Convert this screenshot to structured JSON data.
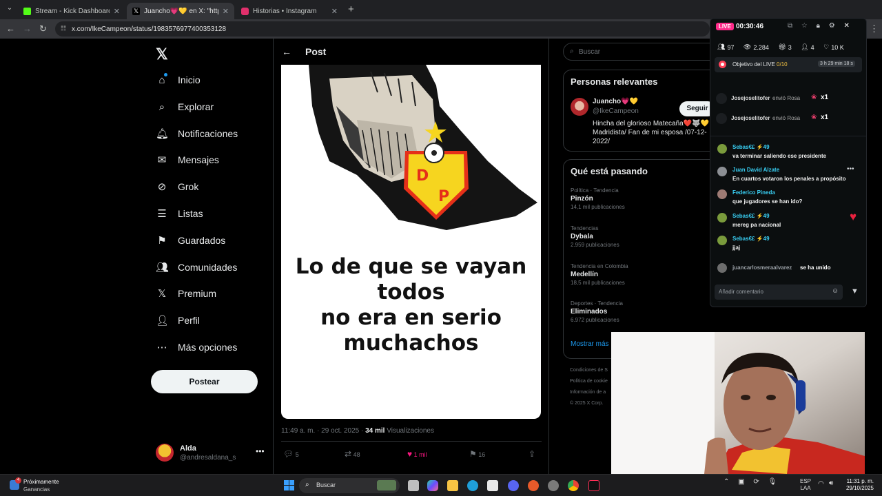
{
  "browser": {
    "tabs": [
      {
        "label": "Stream - Kick Dashboard",
        "color": "#53fc18"
      },
      {
        "label": "Juancho💗💛 en X: \"https://t.co",
        "color": "#000000"
      },
      {
        "label": "Historias • Instagram",
        "color": "#e1306c"
      }
    ],
    "url": "x.com/IkeCampeon/status/1983576977400353128"
  },
  "xnav": {
    "items": [
      {
        "label": "Inicio",
        "icon": "home-icon"
      },
      {
        "label": "Explorar",
        "icon": "search-icon"
      },
      {
        "label": "Notificaciones",
        "icon": "bell-icon"
      },
      {
        "label": "Mensajes",
        "icon": "mail-icon"
      },
      {
        "label": "Grok",
        "icon": "grok-icon"
      },
      {
        "label": "Listas",
        "icon": "list-icon"
      },
      {
        "label": "Guardados",
        "icon": "bookmark-icon"
      },
      {
        "label": "Comunidades",
        "icon": "people-icon"
      },
      {
        "label": "Premium",
        "icon": "x-logo-icon"
      },
      {
        "label": "Perfil",
        "icon": "person-icon"
      },
      {
        "label": "Más opciones",
        "icon": "more-icon"
      }
    ],
    "post_button": "Postear",
    "account": {
      "name": "Alda",
      "handle": "@andresaldana_s"
    }
  },
  "post": {
    "header": "Post",
    "meme_lines": [
      "Lo de que se vayan",
      "todos",
      "no era en serio",
      "muchachos"
    ],
    "meta_time": "11:49 a. m. · 29 oct. 2025 ·",
    "meta_views_count": "34 mil",
    "meta_views_label": "Visualizaciones",
    "actions": {
      "replies": "5",
      "reposts": "48",
      "likes": "1 mil",
      "bookmarks": "16"
    }
  },
  "right": {
    "search_placeholder": "Buscar",
    "relevant_title": "Personas relevantes",
    "person": {
      "name": "Juancho💗💛",
      "handle": "@IkeCampeon",
      "follow": "Seguir",
      "bio": "Hincha del glorioso Matecaña❤️🐺💛 Madridista/ Fan de mi esposa /07-12-2022/"
    },
    "trends_title": "Qué está pasando",
    "trends": [
      {
        "category": "Política · Tendencia",
        "name": "Pinzón",
        "count": "14,1 mil publicaciones"
      },
      {
        "category": "Tendencias",
        "name": "Dybala",
        "count": "2.959 publicaciones"
      },
      {
        "category": "Tendencia en Colombia",
        "name": "Medellín",
        "count": "18,5 mil publicaciones"
      },
      {
        "category": "Deportes · Tendencia",
        "name": "Eliminados",
        "count": "6.972 publicaciones"
      }
    ],
    "show_more": "Mostrar más",
    "footer": [
      "Condiciones de S",
      "Política de cookie",
      "Información de a",
      "© 2025 X Corp."
    ]
  },
  "kick": {
    "live_badge": "LIVE",
    "timer": "00:30:46",
    "stats": {
      "followers": "97",
      "views": "2.284",
      "gifts": "3",
      "subs": "4",
      "likes": "10 K"
    },
    "goal_label": "Objetivo del LIVE",
    "goal_progress": "0/10",
    "goal_time": "3 h 29 min 18 s",
    "gift_events": [
      {
        "user": "Josejoselitofer",
        "action": "envió Rosa",
        "count": "x1"
      },
      {
        "user": "Josejoselitofer",
        "action": "envió Rosa",
        "count": "x1"
      }
    ],
    "messages": [
      {
        "user": "Sebas€£",
        "badge": "49",
        "text": "va terminar saliendo ese presidente",
        "color": "#39d0f5"
      },
      {
        "user": "Juan David Alzate",
        "badge": "",
        "text": "En cuartos votaron los penales a propósito",
        "color": "#39d0f5"
      },
      {
        "user": "Federico Pineda",
        "badge": "",
        "text": "que jugadores se han ido?",
        "color": "#39d0f5"
      },
      {
        "user": "Sebas€£",
        "badge": "49",
        "text": "mereg pa nacional",
        "color": "#39d0f5"
      },
      {
        "user": "Sebas€£",
        "badge": "49",
        "text": "jjaj",
        "color": "#39d0f5"
      }
    ],
    "join_user": "juancarlosmeraalvarez",
    "join_text": "se ha unido",
    "comment_placeholder": "Añadir comentario"
  },
  "taskbar": {
    "weather_badge": "4",
    "weather_line1": "Próximamente",
    "weather_line2": "Ganancias",
    "search_label": "Buscar",
    "lang1": "ESP",
    "lang2": "LAA",
    "time": "11:31 p. m.",
    "date": "29/10/2025"
  }
}
